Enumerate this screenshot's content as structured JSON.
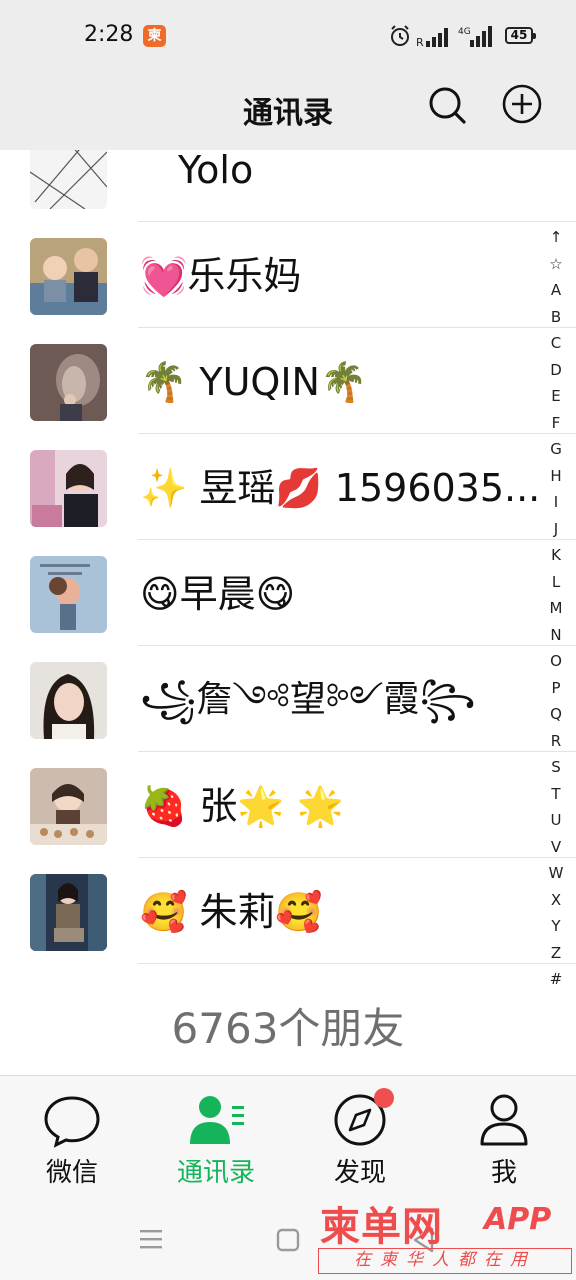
{
  "status_bar": {
    "time": "2:28",
    "app_badge": "柬",
    "battery": "45"
  },
  "header": {
    "title": "通讯录"
  },
  "contacts": [
    {
      "name": "Yolo"
    },
    {
      "name": "💓乐乐妈"
    },
    {
      "name": "🌴 YUQIN🌴"
    },
    {
      "name": "✨ 昱瑶💋 1596035..."
    },
    {
      "name": "😋早晨😋"
    },
    {
      "name": "꧁詹༺望༻霞꧂"
    },
    {
      "name": "🍓 张🌟 🌟"
    },
    {
      "name": "🥰 朱莉🥰"
    }
  ],
  "alpha_index": [
    "↑",
    "☆",
    "A",
    "B",
    "C",
    "D",
    "E",
    "F",
    "G",
    "H",
    "I",
    "J",
    "K",
    "L",
    "M",
    "N",
    "O",
    "P",
    "Q",
    "R",
    "S",
    "T",
    "U",
    "V",
    "W",
    "X",
    "Y",
    "Z",
    "#"
  ],
  "friend_count": "6763个朋友",
  "tabs": [
    {
      "label": "微信",
      "icon": "chat-bubble-icon"
    },
    {
      "label": "通讯录",
      "icon": "contacts-icon",
      "active": true
    },
    {
      "label": "发现",
      "icon": "compass-icon"
    },
    {
      "label": "我",
      "icon": "person-icon"
    }
  ],
  "watermark": {
    "title": "柬单网",
    "app": "APP",
    "slogan": "在柬华人都在用"
  },
  "colors": {
    "accent": "#15b45a",
    "badge_red": "#f04f4f",
    "header_bg": "#ededed",
    "watermark_red": "#ef4d4d"
  }
}
